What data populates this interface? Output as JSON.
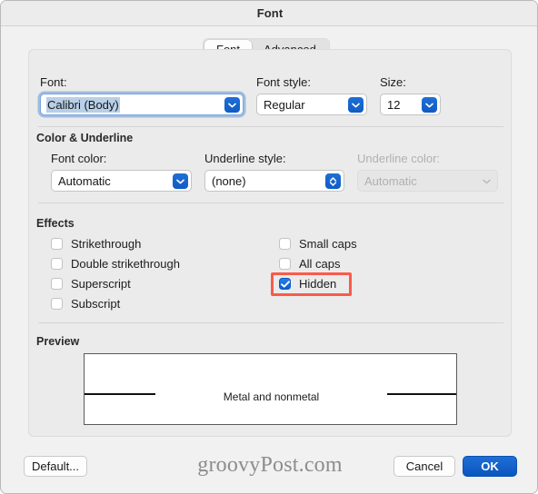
{
  "window": {
    "title": "Font"
  },
  "tabs": [
    {
      "label": "Font",
      "active": true
    },
    {
      "label": "Advanced",
      "active": false
    }
  ],
  "font_section": {
    "font_label": "Font:",
    "font_value": "Calibri (Body)",
    "style_label": "Font style:",
    "style_value": "Regular",
    "size_label": "Size:",
    "size_value": "12"
  },
  "color_underline_section": {
    "heading": "Color & Underline",
    "font_color_label": "Font color:",
    "font_color_value": "Automatic",
    "underline_style_label": "Underline style:",
    "underline_style_value": "(none)",
    "underline_color_label": "Underline color:",
    "underline_color_value": "Automatic"
  },
  "effects_section": {
    "heading": "Effects",
    "left_column": [
      {
        "label": "Strikethrough",
        "checked": false
      },
      {
        "label": "Double strikethrough",
        "checked": false
      },
      {
        "label": "Superscript",
        "checked": false
      },
      {
        "label": "Subscript",
        "checked": false
      }
    ],
    "right_column": [
      {
        "label": "Small caps",
        "checked": false
      },
      {
        "label": "All caps",
        "checked": false
      },
      {
        "label": "Hidden",
        "checked": true
      }
    ]
  },
  "preview_section": {
    "heading": "Preview",
    "text": "Metal and nonmetal"
  },
  "footer": {
    "default_label": "Default...",
    "cancel_label": "Cancel",
    "ok_label": "OK",
    "watermark": "groovyPost.com"
  },
  "colors": {
    "accent_blue": "#0a56c0",
    "highlight_red": "#fa5a4b",
    "selection_blue": "#b8cfe8",
    "panel_gray": "#ebebeb"
  }
}
